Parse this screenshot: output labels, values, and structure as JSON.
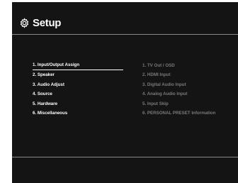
{
  "header": {
    "title": "Setup",
    "icon": "gear-icon"
  },
  "menu": {
    "selected_index": 0,
    "items": [
      {
        "label": "1. Input/Output Assign"
      },
      {
        "label": "2. Speaker"
      },
      {
        "label": "3. Audio Adjust"
      },
      {
        "label": "4. Source"
      },
      {
        "label": "5. Hardware"
      },
      {
        "label": "6. Miscellaneous"
      }
    ]
  },
  "submenu": {
    "items": [
      {
        "label": "1. TV Out / OSD"
      },
      {
        "label": "2. HDMI Input"
      },
      {
        "label": "3. Digital Audio Input"
      },
      {
        "label": "4. Analog Audio Input"
      },
      {
        "label": "5. Input Skip"
      },
      {
        "label": "6. PERSONAL PRESET Information"
      }
    ]
  },
  "colors": {
    "background": "#141414",
    "text": "#ffffff",
    "submenu_text": "#7a7a7a",
    "divider": "#8a8a8a"
  }
}
